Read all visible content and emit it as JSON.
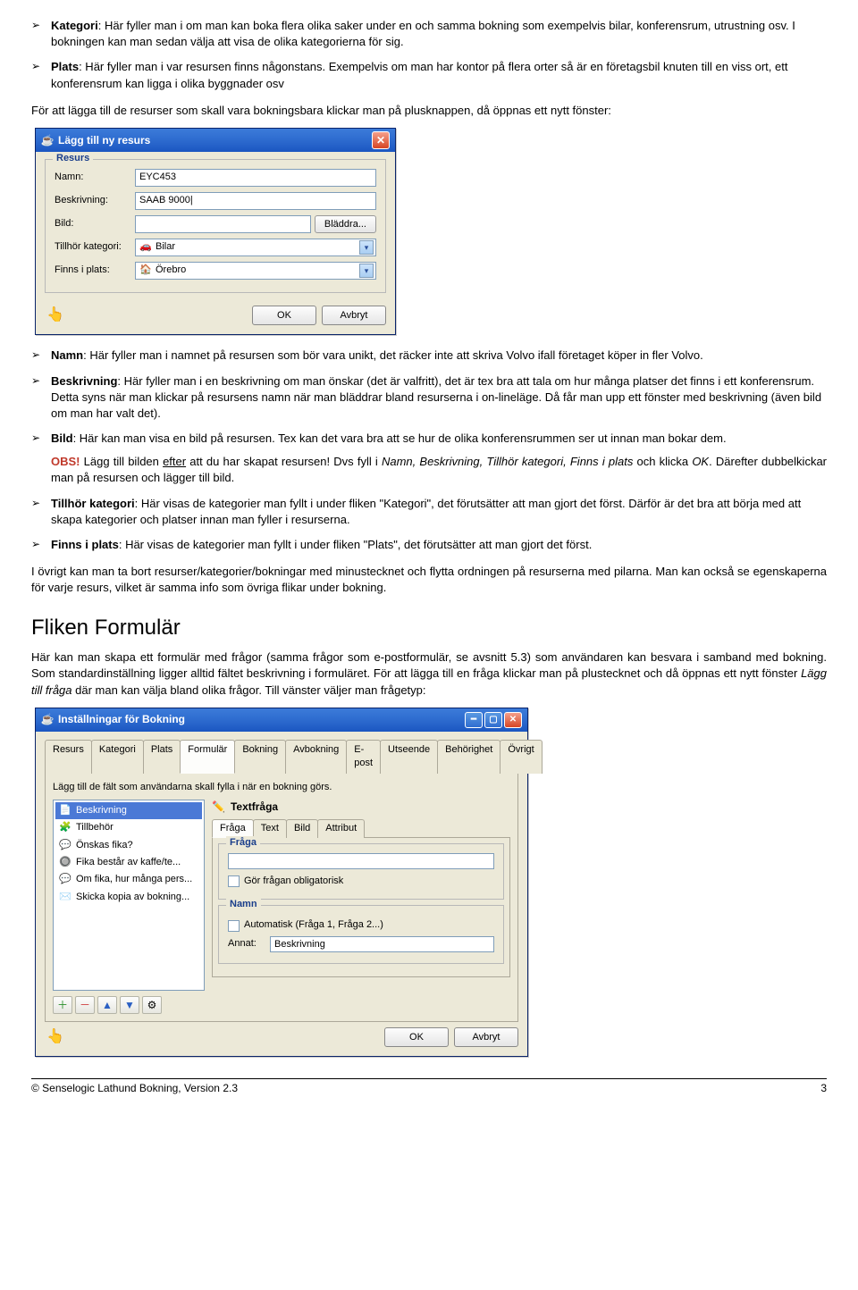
{
  "bullets_top": [
    {
      "label": "Kategori",
      "text": ": Här fyller man i om man kan boka flera olika saker under en och samma bokning som exempelvis bilar, konferensrum, utrustning osv. I bokningen kan man sedan välja att visa de olika kategorierna för sig."
    },
    {
      "label": "Plats",
      "text": ": Här fyller man i var resursen finns någonstans. Exempelvis om man har kontor på flera orter så är en företagsbil knuten till en viss ort, ett konferensrum kan ligga i olika byggnader osv"
    }
  ],
  "intro_para": "För att lägga till de resurser som skall vara bokningsbara klickar man på plusknappen, då öppnas ett nytt fönster:",
  "dialog1": {
    "title": "Lägg till ny resurs",
    "group": "Resurs",
    "rows": {
      "name_label": "Namn:",
      "name_value": "EYC453",
      "desc_label": "Beskrivning:",
      "desc_value": "SAAB 9000|",
      "image_label": "Bild:",
      "browse": "Bläddra...",
      "category_label": "Tillhör kategori:",
      "category_value": "Bilar",
      "place_label": "Finns i plats:",
      "place_value": "Örebro"
    },
    "ok": "OK",
    "cancel": "Avbryt"
  },
  "bullets_mid": [
    {
      "label": "Namn",
      "text": ": Här fyller man i namnet på resursen som bör vara unikt, det räcker inte att skriva Volvo ifall företaget köper in fler Volvo."
    },
    {
      "label": "Beskrivning",
      "text": ": Här fyller man i en beskrivning om man önskar (det är valfritt), det är tex bra att tala om hur många platser det finns i ett konferensrum. Detta syns när man klickar på resursens namn när man bläddrar bland resurserna i on-lineläge. Då får man upp ett fönster med beskrivning (även bild om man har valt det)."
    },
    {
      "label": "Bild",
      "text": ": Här kan man visa en bild på resursen. Tex kan det vara bra att se hur de olika konferensrummen ser ut innan man bokar dem."
    }
  ],
  "obs_label": "OBS!",
  "obs_text_before": " Lägg till bilden ",
  "obs_underline": "efter",
  "obs_text_after": " att du har skapat resursen! Dvs fyll i ",
  "obs_italic": "Namn, Beskrivning, Tillhör kategori, Finns i plats",
  "obs_after_italic": " och klicka ",
  "obs_ok": "OK",
  "obs_tail": ". Därefter dubbelkickar man på resursen och lägger till bild.",
  "bullets_mid2": [
    {
      "label": "Tillhör kategori",
      "text": ": Här visas de kategorier man fyllt i under fliken \"Kategori\", det förutsätter att man gjort det först. Därför är det bra att börja med att skapa kategorier och platser innan man fyller i resurserna."
    },
    {
      "label": "Finns i plats",
      "text": ": Här visas de kategorier man fyllt i under fliken \"Plats\", det förutsätter att man gjort det först."
    }
  ],
  "extra_para": "I övrigt kan man ta bort resurser/kategorier/bokningar med minustecknet och flytta ordningen på resurserna med pilarna. Man kan också se egenskaperna för varje resurs, vilket är samma info som övriga flikar under bokning.",
  "section2_title": "Fliken Formulär",
  "section2_para_a": "Här kan man skapa ett formulär med frågor (samma frågor som e-postformulär, se avsnitt 5.3) som användaren kan besvara i samband med bokning. Som standardinställning ligger alltid fältet beskrivning i formuläret. För att lägga till en fråga klickar man på plustecknet och då öppnas ett nytt fönster ",
  "section2_para_italic": "Lägg till fråga",
  "section2_para_b": " där man kan välja bland olika frågor. Till vänster väljer man frågetyp:",
  "dialog2": {
    "title": "Inställningar för Bokning",
    "tabs": [
      "Resurs",
      "Kategori",
      "Plats",
      "Formulär",
      "Bokning",
      "Avbokning",
      "E-post",
      "Utseende",
      "Behörighet",
      "Övrigt"
    ],
    "active_tab": "Formulär",
    "hint": "Lägg till de fält som användarna skall fylla i när en bokning görs.",
    "left_items": [
      {
        "icon": "📄",
        "label": "Beskrivning",
        "sel": true
      },
      {
        "icon": "🧩",
        "label": "Tillbehör"
      },
      {
        "icon": "💬",
        "label": "Önskas fika?"
      },
      {
        "icon": "🔘",
        "label": "Fika består av kaffe/te..."
      },
      {
        "icon": "💬",
        "label": "Om fika, hur många pers..."
      },
      {
        "icon": "✉️",
        "label": "Skicka kopia av bokning..."
      }
    ],
    "right_title": "Textfråga",
    "inner_tabs": [
      "Fråga",
      "Text",
      "Bild",
      "Attribut"
    ],
    "inner_active": "Fråga",
    "group_fraga": "Fråga",
    "chk_mandatory": "Gör frågan obligatorisk",
    "group_namn": "Namn",
    "chk_auto": "Automatisk (Fråga 1, Fråga 2...)",
    "annat_label": "Annat:",
    "annat_value": "Beskrivning",
    "ok": "OK",
    "cancel": "Avbryt"
  },
  "footer_left": "© Senselogic Lathund Bokning, Version 2.3",
  "footer_right": "3"
}
